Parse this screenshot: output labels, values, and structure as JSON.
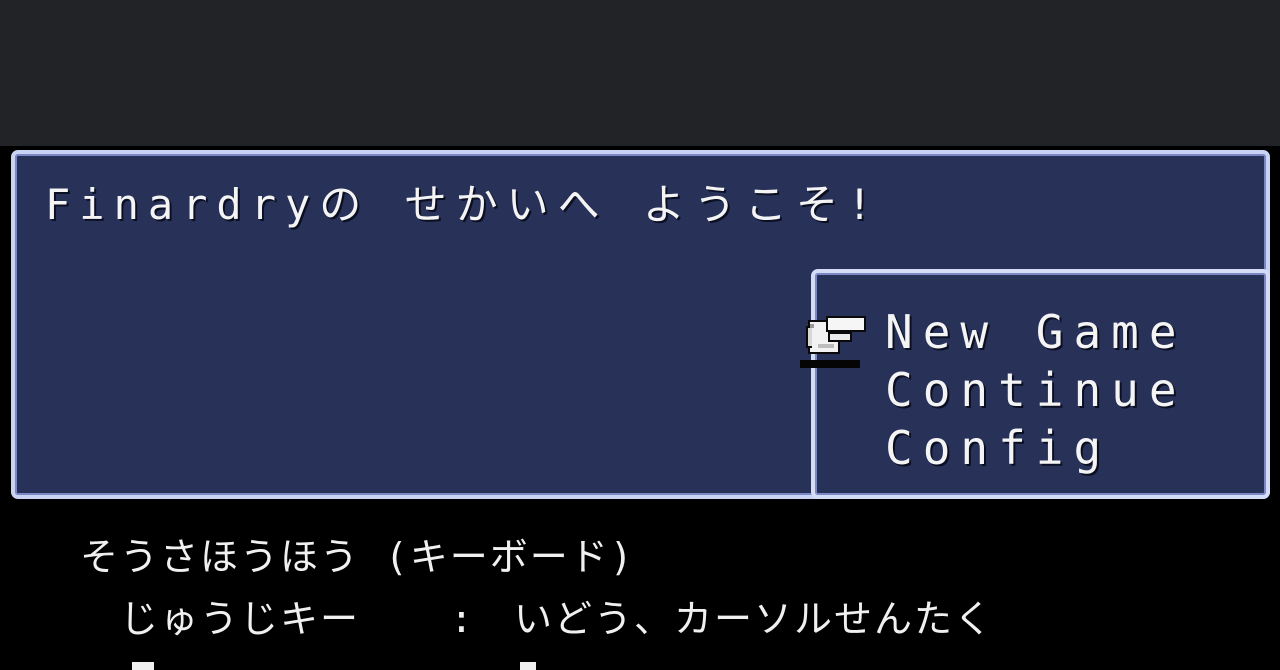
{
  "message": {
    "text": "Finardryの せかいへ ようこそ!"
  },
  "menu": {
    "items": [
      {
        "label": "New Game"
      },
      {
        "label": "Continue"
      },
      {
        "label": "Config"
      }
    ],
    "selected_index": 0
  },
  "cursor": {
    "icon": "pointing-hand-icon"
  },
  "help": {
    "title": "そうさほうほう (キーボード)",
    "rows": [
      {
        "key": "じゅうじキー",
        "separator": ":",
        "action": "いどう、カーソルせんたく"
      }
    ]
  },
  "colors": {
    "window_fill": "#283158",
    "window_border": "#c9d3f4",
    "text": "#f4f4f4",
    "background": "#000000",
    "top_bar": "#222326"
  }
}
